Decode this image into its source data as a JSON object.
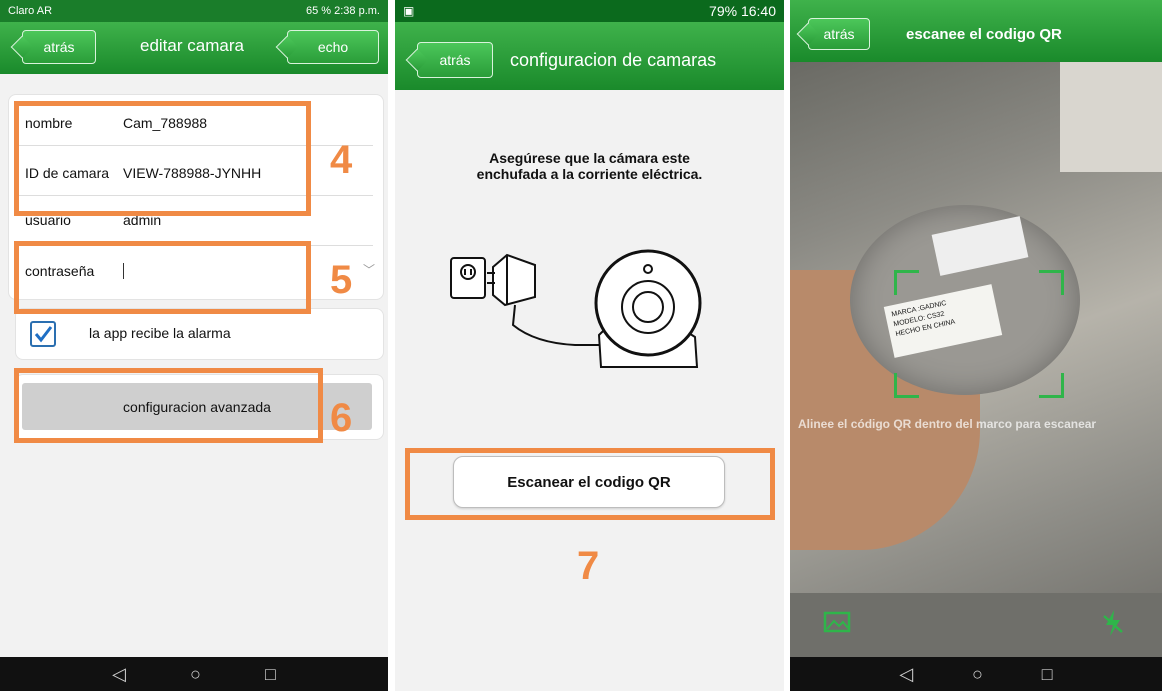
{
  "phone1": {
    "status": {
      "carrier": "Claro AR",
      "right": "65 %  2:38 p.m."
    },
    "appbar": {
      "back": "atrás",
      "title": "editar camara",
      "done": "echo"
    },
    "fields": [
      {
        "label": "nombre",
        "value": "Cam_788988"
      },
      {
        "label": "ID de camara",
        "value": "VIEW-788988-JYNHH"
      },
      {
        "label": "usuario",
        "value": "admin"
      },
      {
        "label": "contraseña",
        "value": ""
      }
    ],
    "alarm_label": "la app recibe la alarma",
    "advanced_button": "configuracion avanzada",
    "callouts": [
      "4",
      "5",
      "6"
    ]
  },
  "phone2": {
    "status": {
      "right": "79% 16:40"
    },
    "appbar": {
      "back": "atrás",
      "title": "configuracion de camaras"
    },
    "instruction": [
      "Asegúrese que la cámara este",
      "enchufada a la corriente eléctrica."
    ],
    "scan_button": "Escanear el codigo QR",
    "callout": "7"
  },
  "phone3": {
    "appbar": {
      "back": "atrás",
      "title": "escanee el codigo QR"
    },
    "hint": "Alinee el código QR dentro del marco para escanear",
    "sticker": [
      "MARCA :GADNIC",
      "MODELO: CS32",
      "HECHO EN CHINA"
    ],
    "accent": "#2fb54a"
  },
  "colors": {
    "accent": "#f08a45",
    "green": "#2a9d39"
  }
}
